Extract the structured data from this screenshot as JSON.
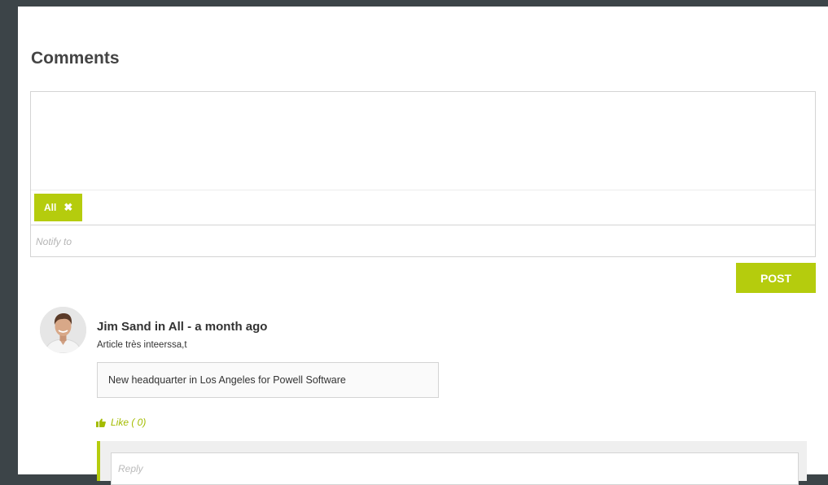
{
  "section": {
    "title": "Comments"
  },
  "composer": {
    "tag_label": "All",
    "tag_remove_glyph": "✖",
    "notify_placeholder": "Notify to",
    "post_label": "POST"
  },
  "comment": {
    "author_line": "Jim Sand in All - a month ago",
    "text": "Article très inteerssa,t",
    "article_title": "New headquarter in Los Angeles for Powell Software",
    "like_label": "Like ( 0)",
    "like_icon": "thumbs-up-icon",
    "reply_placeholder": "Reply"
  },
  "colors": {
    "accent": "#b5cc0d",
    "background": "#3c4448"
  }
}
